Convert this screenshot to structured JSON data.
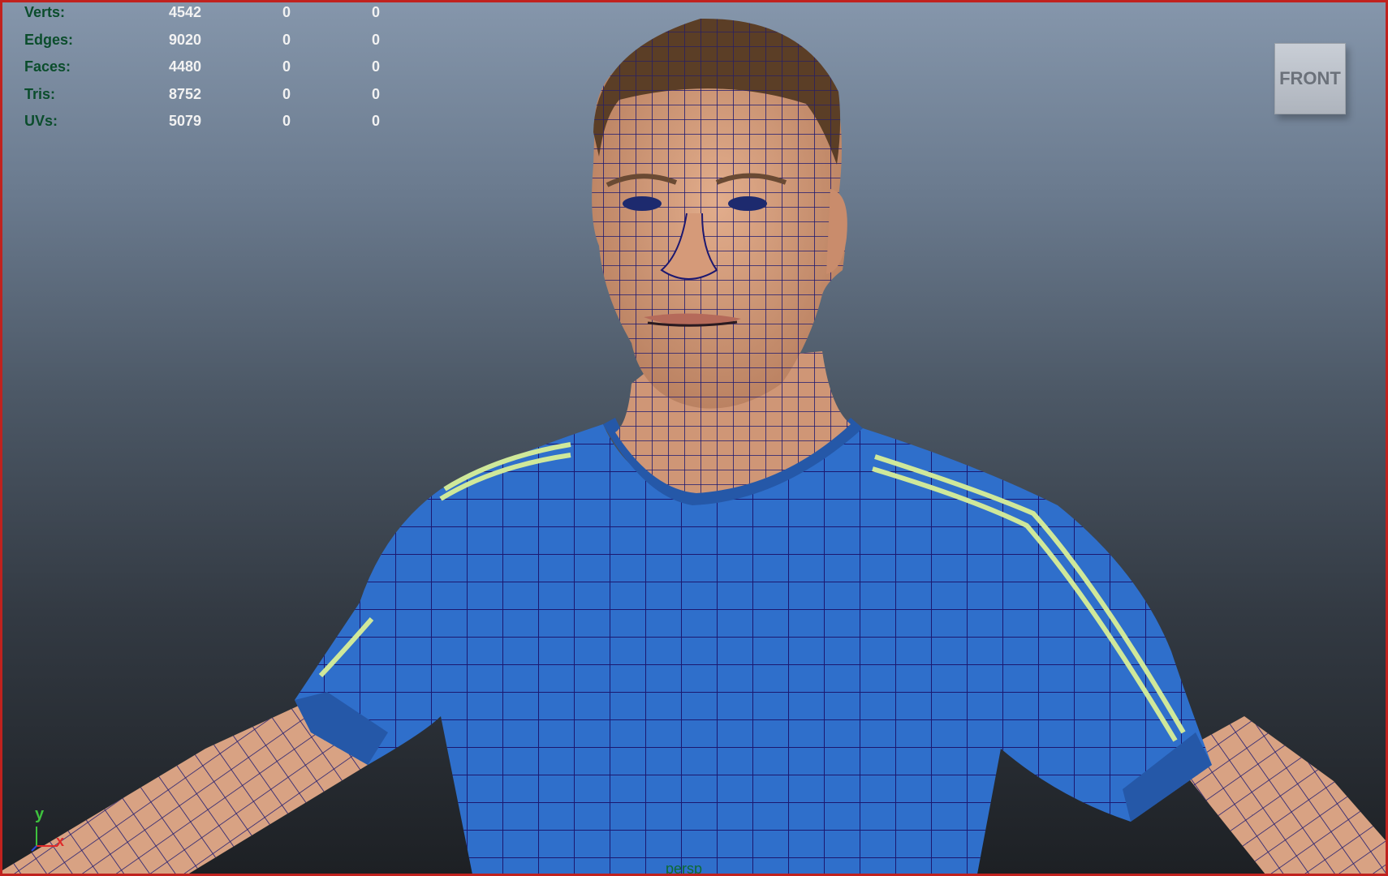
{
  "hud": {
    "rows": [
      {
        "label": "Verts:",
        "v1": "4542",
        "v2": "0",
        "v3": "0"
      },
      {
        "label": "Edges:",
        "v1": "9020",
        "v2": "0",
        "v3": "0"
      },
      {
        "label": "Faces:",
        "v1": "4480",
        "v2": "0",
        "v3": "0"
      },
      {
        "label": "Tris:",
        "v1": "8752",
        "v2": "0",
        "v3": "0"
      },
      {
        "label": "UVs:",
        "v1": "5079",
        "v2": "0",
        "v3": "0"
      }
    ]
  },
  "viewcube": {
    "label": "FRONT"
  },
  "axis": {
    "y": "y",
    "x": "x"
  },
  "camera": {
    "label": "persp"
  },
  "colors": {
    "skin": "#d9a07e",
    "shirt": "#2f6fcb",
    "stripe": "#cfe89a",
    "wire": "#1c1870",
    "hud_label": "#0b4d2c",
    "border": "#c0221e"
  }
}
